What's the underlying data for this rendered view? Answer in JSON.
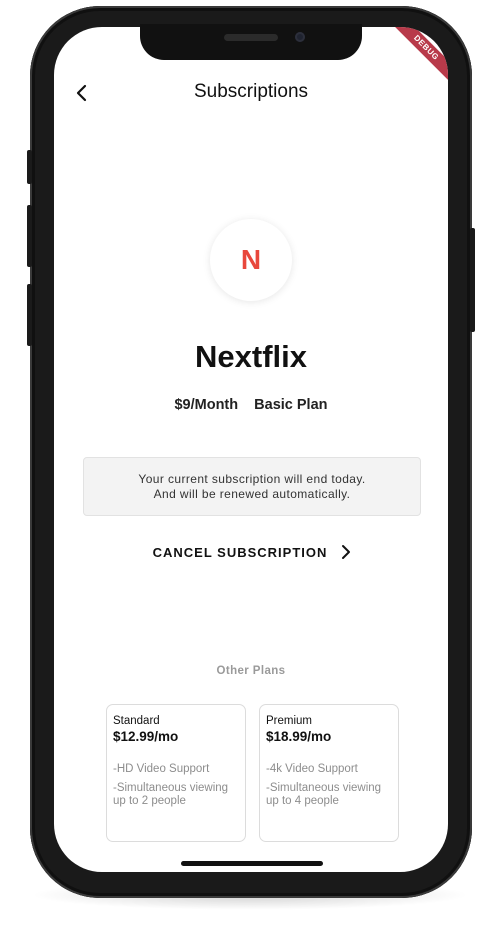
{
  "app_bar": {
    "title": "Subscriptions",
    "back_icon": "chevron-left-icon"
  },
  "debug_banner": "DEBUG",
  "service": {
    "logo_letter": "N",
    "logo_color": "#e8473c",
    "name": "Nextflix",
    "price": "$9/Month",
    "plan": "Basic Plan"
  },
  "notice": {
    "line1": "Your current subscription will end today.",
    "line2": "And will be renewed automatically."
  },
  "cancel": {
    "label": "CANCEL SUBSCRIPTION",
    "icon": "chevron-right-icon"
  },
  "other_plans": {
    "heading": "Other Plans",
    "plans": [
      {
        "name": "Standard",
        "price": "$12.99/mo",
        "features": [
          "-HD Video Support",
          "-Simultaneous viewing up to 2 people"
        ]
      },
      {
        "name": "Premium",
        "price": "$18.99/mo",
        "features": [
          "-4k Video Support",
          "-Simultaneous viewing up to 4 people"
        ]
      }
    ]
  }
}
